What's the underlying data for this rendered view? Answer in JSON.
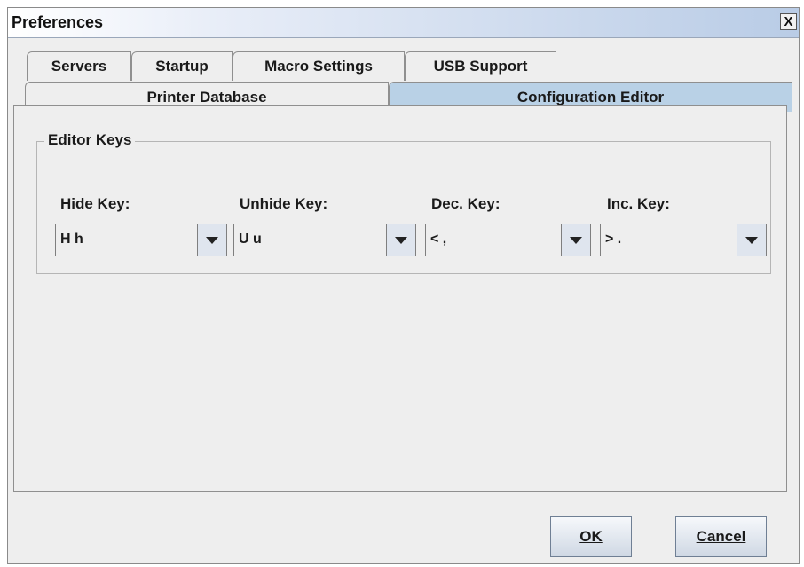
{
  "window": {
    "title": "Preferences",
    "close_glyph": "X"
  },
  "tabs_row1": [
    {
      "label": "Servers"
    },
    {
      "label": "Startup"
    },
    {
      "label": "Macro Settings"
    },
    {
      "label": "USB Support"
    }
  ],
  "tabs_row2": [
    {
      "label": "Printer Database"
    },
    {
      "label": "Configuration Editor"
    }
  ],
  "selected_tab": "Configuration Editor",
  "editor_keys": {
    "group_title": "Editor Keys",
    "fields": [
      {
        "label": "Hide Key:",
        "value": "H h"
      },
      {
        "label": "Unhide Key:",
        "value": "U u"
      },
      {
        "label": "Dec. Key:",
        "value": "< ,"
      },
      {
        "label": "Inc. Key:",
        "value": "> ."
      }
    ]
  },
  "buttons": {
    "ok": "OK",
    "cancel": "Cancel"
  },
  "colors": {
    "selected_tab": "#b9d1e6",
    "panel_bg": "#eeeeee",
    "titlebar_gradient_end": "#b9cce6"
  }
}
